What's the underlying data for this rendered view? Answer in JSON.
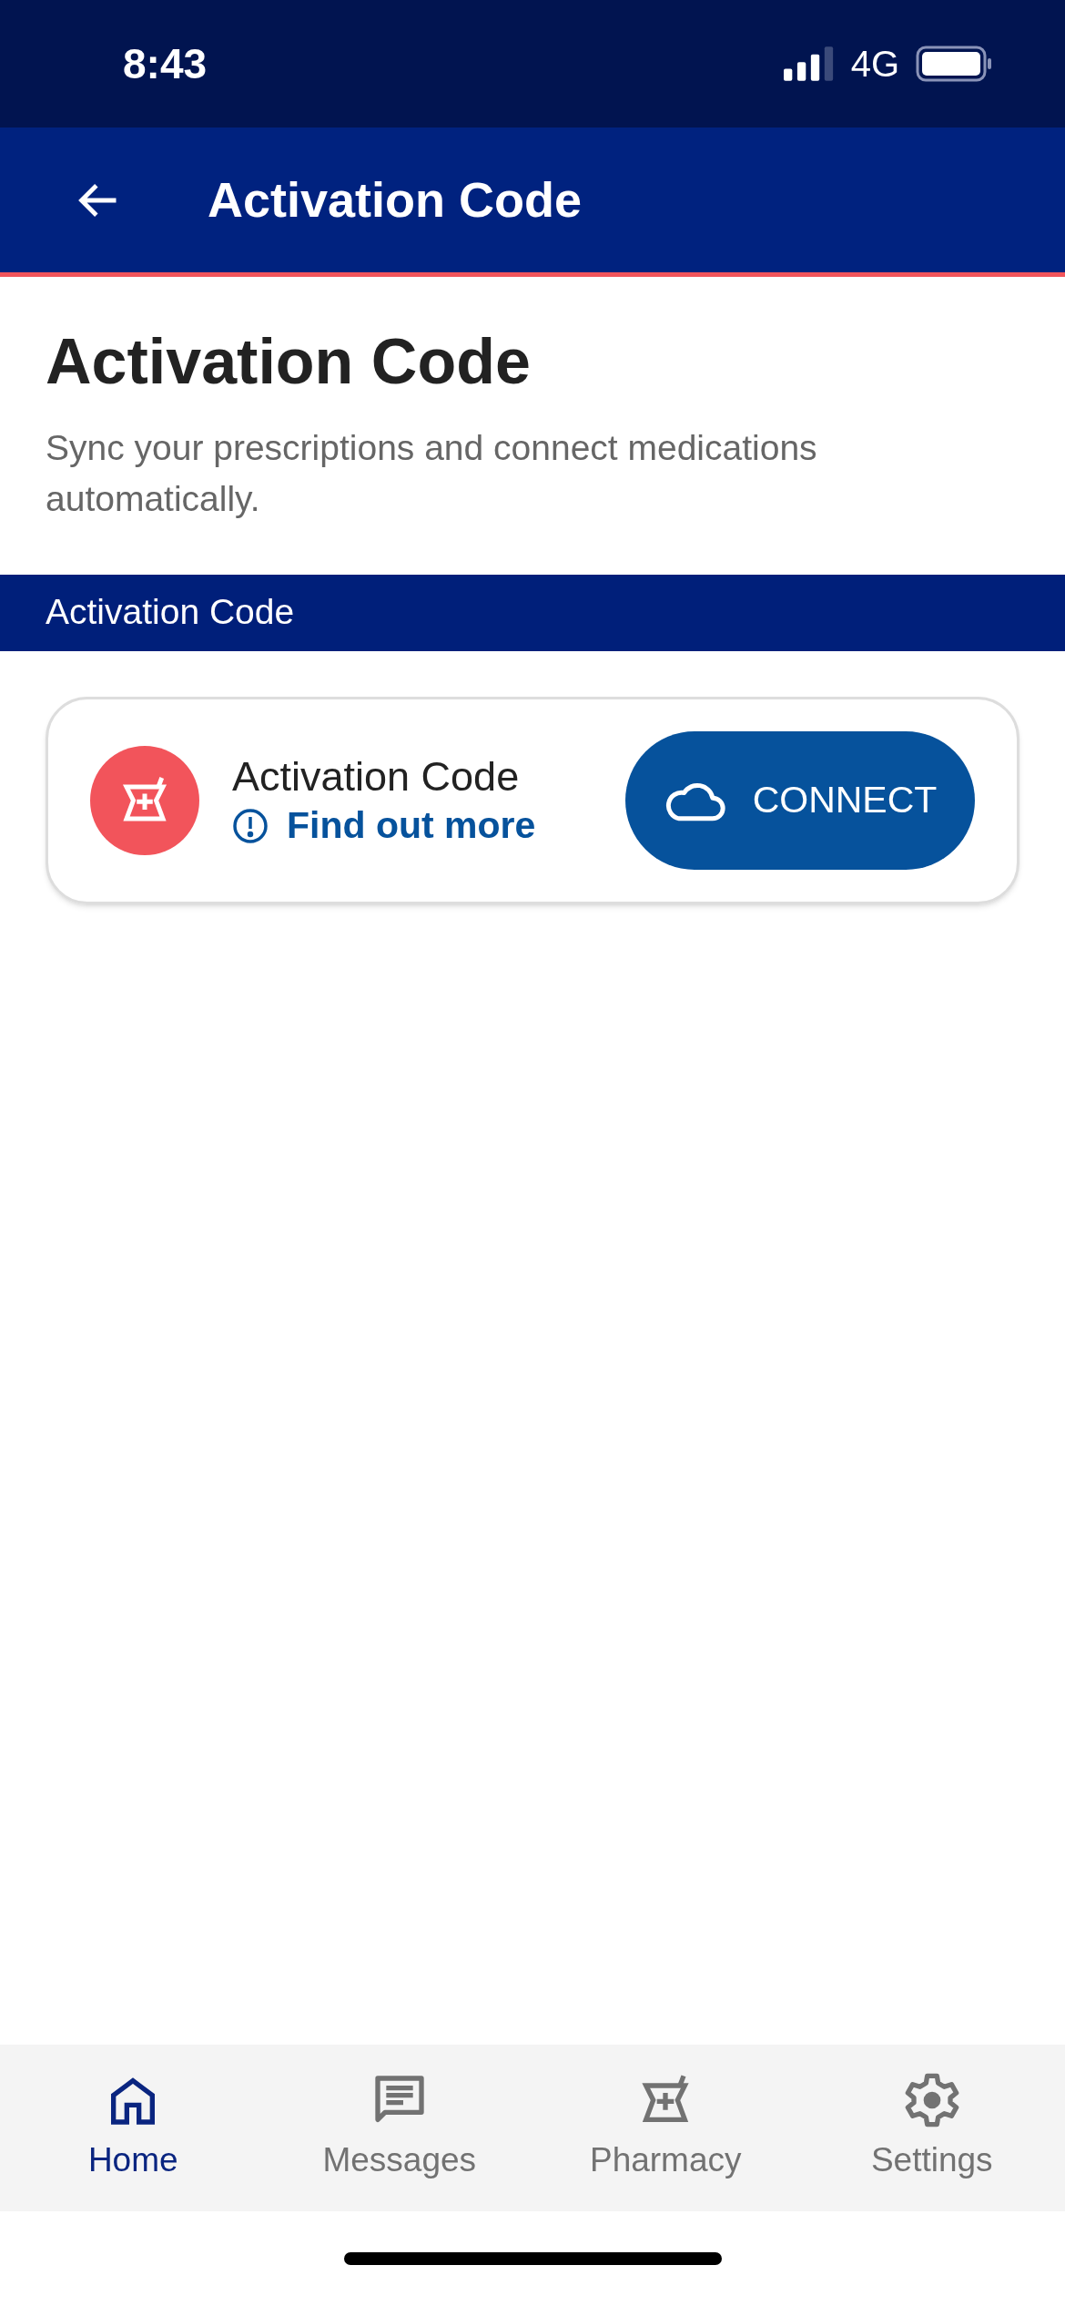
{
  "status_bar": {
    "time": "8:43",
    "network": "4G"
  },
  "header": {
    "title": "Activation Code"
  },
  "page": {
    "title": "Activation Code",
    "description": "Sync your prescriptions and connect medications automatically."
  },
  "section": {
    "title": "Activation Code"
  },
  "card": {
    "title": "Activation Code",
    "link": "Find out more",
    "button": "CONNECT"
  },
  "tabs": [
    {
      "label": "Home",
      "kind": "home",
      "selected": true
    },
    {
      "label": "Messages",
      "kind": "messages",
      "selected": false
    },
    {
      "label": "Pharmacy",
      "kind": "pharmacy",
      "selected": false
    },
    {
      "label": "Settings",
      "kind": "settings",
      "selected": false
    }
  ]
}
